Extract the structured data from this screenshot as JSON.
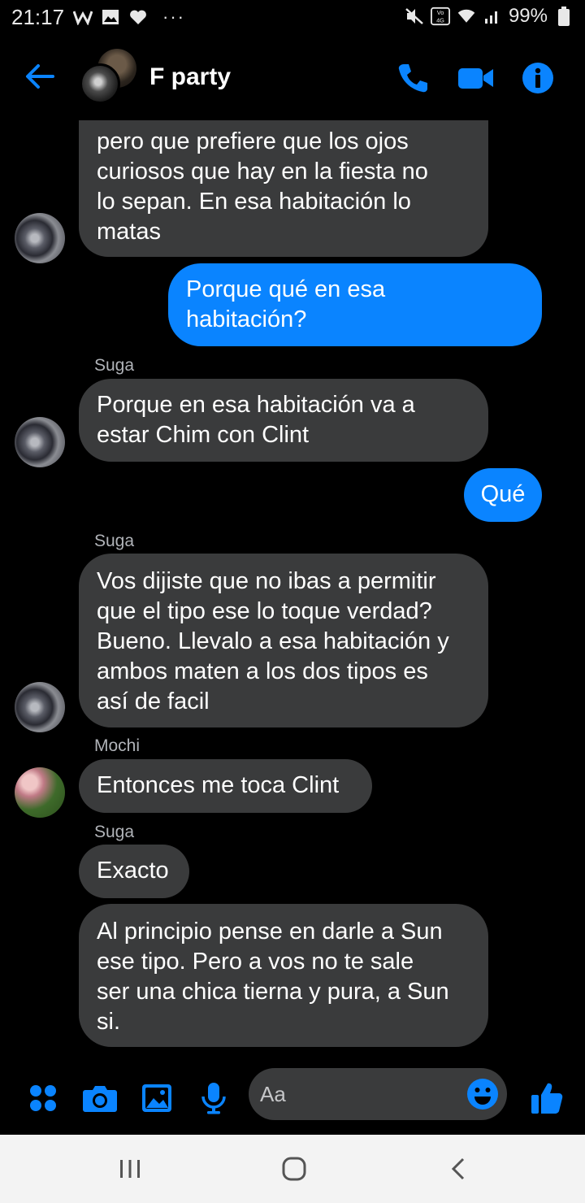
{
  "status_bar": {
    "time": "21:17",
    "battery": "99%",
    "network": "VoLTE 4G",
    "more": "···"
  },
  "header": {
    "title": "F party",
    "accent_color": "#0a84ff"
  },
  "messages": [
    {
      "direction": "in",
      "sender": "",
      "lines": [
        "pero que prefiere que los ojos",
        "curiosos que hay en la fiesta no",
        "lo sepan. En esa habitación lo",
        "matas"
      ],
      "avatar": "suga"
    },
    {
      "direction": "out",
      "lines": [
        "Porque qué en esa",
        "habitación?"
      ]
    },
    {
      "direction": "in",
      "sender": "Suga",
      "lines": [
        "Porque en esa habitación va a",
        "estar Chim con Clint"
      ],
      "avatar": "suga"
    },
    {
      "direction": "out",
      "lines": [
        "Qué"
      ]
    },
    {
      "direction": "in",
      "sender": "Suga",
      "lines": [
        "Vos dijiste que no ibas a permitir",
        "que el tipo ese lo toque verdad?",
        "Bueno. Llevalo a esa habitación y",
        "ambos maten a los dos tipos es",
        "así de facil"
      ],
      "avatar": "suga"
    },
    {
      "direction": "in",
      "sender": "Mochi",
      "lines": [
        "Entonces me toca Clint"
      ],
      "avatar": "mochi"
    },
    {
      "direction": "in",
      "sender": "Suga",
      "lines": [
        "Exacto"
      ]
    },
    {
      "direction": "in",
      "sender": "",
      "lines": [
        "Al principio pense en darle a Sun",
        "ese tipo. Pero a vos no te sale",
        "ser una chica tierna y pura, a Sun",
        "si."
      ]
    }
  ],
  "composer": {
    "placeholder": "Aa"
  },
  "icons": {
    "back": "back-arrow-icon",
    "call": "phone-icon",
    "video": "video-camera-icon",
    "info": "info-icon",
    "apps": "four-dots-icon",
    "camera": "camera-icon",
    "gallery": "image-icon",
    "mic": "microphone-icon",
    "emoji": "smiley-icon",
    "like": "thumbs-up-icon"
  }
}
